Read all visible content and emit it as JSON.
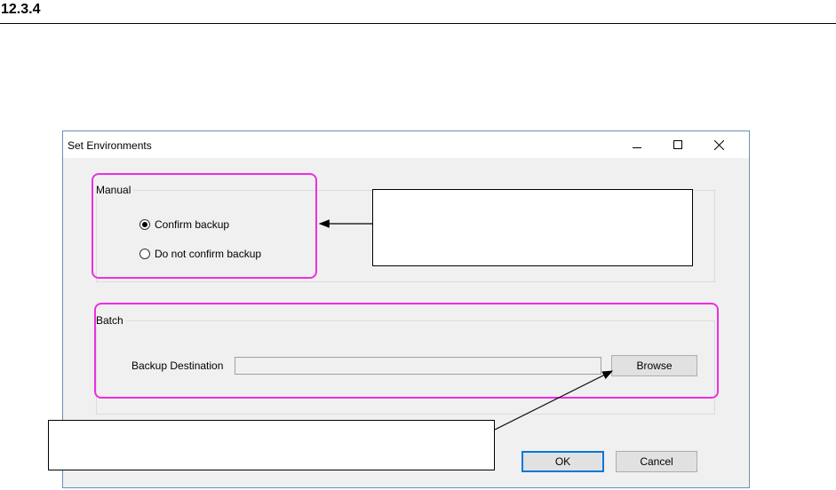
{
  "section": {
    "number": "12.3.4"
  },
  "dialog": {
    "title": "Set Environments",
    "manual": {
      "legend": "Manual",
      "options": [
        {
          "label": "Confirm backup",
          "checked": true
        },
        {
          "label": "Do not confirm backup",
          "checked": false
        }
      ]
    },
    "batch": {
      "legend": "Batch",
      "destination_label": "Backup Destination",
      "destination_value": "",
      "browse_label": "Browse"
    },
    "ok_label": "OK",
    "cancel_label": "Cancel"
  },
  "callouts": {
    "top_text": "",
    "bottom_text": ""
  },
  "colors": {
    "highlight": "#ee2ee2",
    "default_button_border": "#0078d7"
  }
}
